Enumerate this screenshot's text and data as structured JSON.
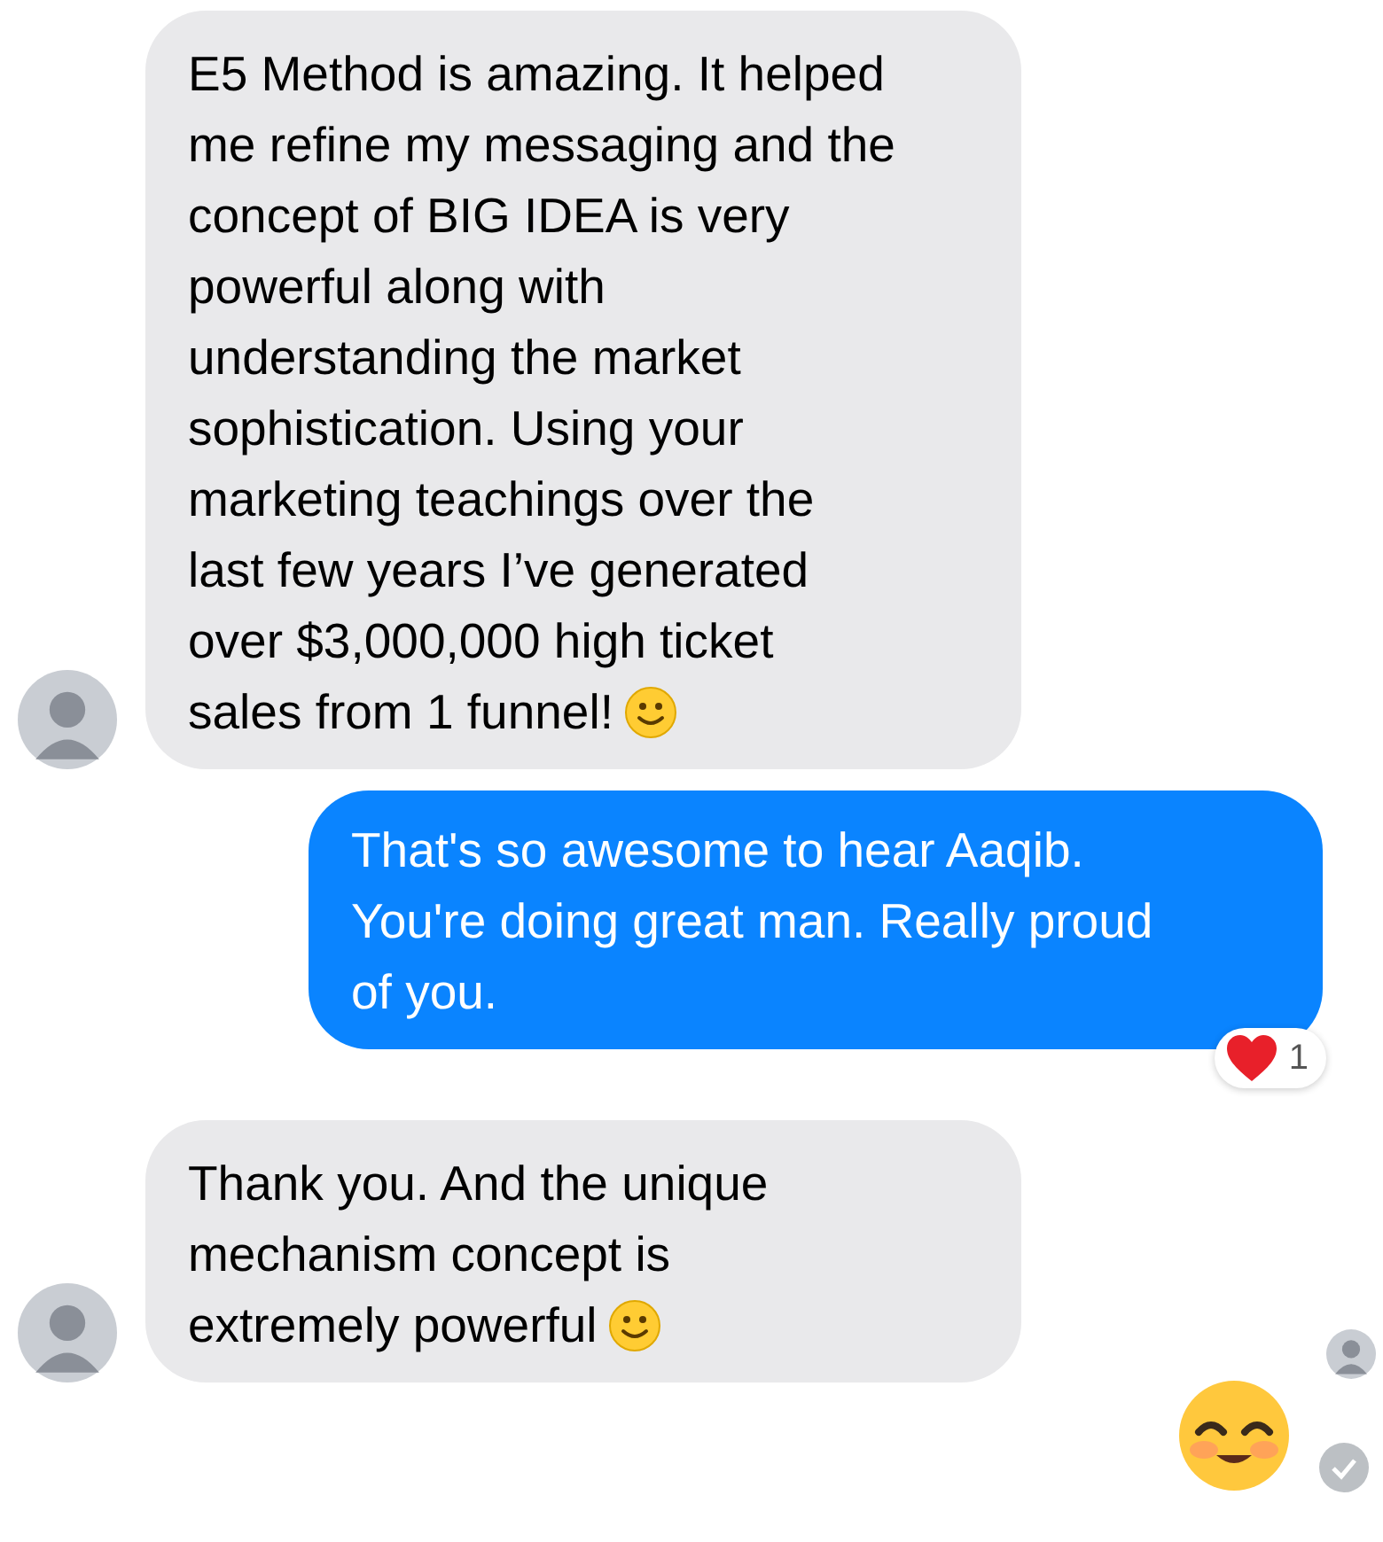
{
  "messages": [
    {
      "kind": "incoming",
      "text": "E5 Method is amazing. It helped\nme refine my messaging and the\nconcept of BIG IDEA is very\npowerful along with\nunderstanding the market\nsophistication. Using your\nmarketing teachings over the\nlast few years I’ve generated\nover $3,000,000 high ticket\nsales from 1 funnel!",
      "trailing_emoji": true,
      "avatar": true
    },
    {
      "kind": "outgoing",
      "text": "That's so awesome to hear Aaqib.\nYou're doing great man. Really proud\nof you.",
      "reaction": {
        "count": "1"
      }
    },
    {
      "kind": "incoming",
      "text": "Thank you. And the unique\nmechanism concept is\nextremely powerful",
      "trailing_emoji": true,
      "avatar": true,
      "seen_avatar": true
    },
    {
      "kind": "outgoing_emoji",
      "read": true
    }
  ]
}
